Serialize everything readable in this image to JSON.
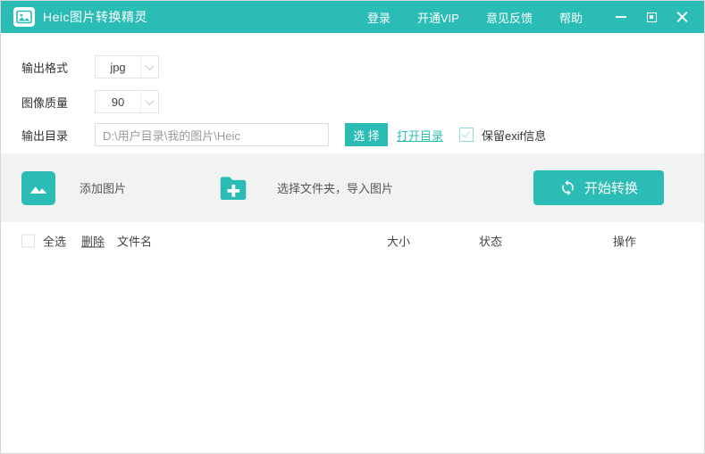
{
  "titlebar": {
    "title": "Heic图片转换精灵",
    "menu": [
      {
        "label": "登录"
      },
      {
        "label": "开通VIP"
      },
      {
        "label": "意见反馈"
      },
      {
        "label": "帮助"
      }
    ]
  },
  "form": {
    "output_format_label": "输出格式",
    "output_format_value": "jpg",
    "image_quality_label": "图像质量",
    "image_quality_value": "90",
    "output_dir_label": "输出目录",
    "output_dir_value": "D:\\用户目录\\我的图片\\Heic",
    "choose_button": "选 择",
    "open_dir_link": "打开目录",
    "exif_label": "保留exif信息",
    "exif_checked": true
  },
  "actions": {
    "add_images_label": "添加图片",
    "import_folder_label": "选择文件夹，导入图片",
    "start_convert_label": "开始转换"
  },
  "table": {
    "select_all_label": "全选",
    "delete_label": "删除",
    "col_filename": "文件名",
    "col_size": "大小",
    "col_status": "状态",
    "col_operation": "操作",
    "rows": []
  },
  "colors": {
    "accent": "#2bbdb5",
    "band_bg": "#f1f2f2"
  }
}
